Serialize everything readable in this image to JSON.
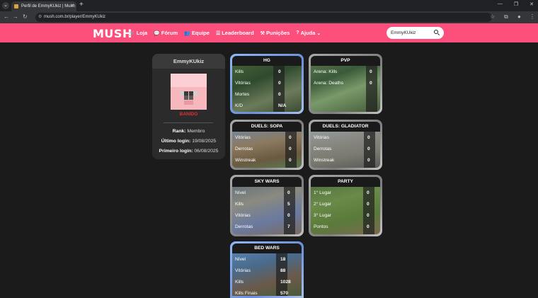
{
  "browser": {
    "tab_title": "Perfil de EmmyKUkiz | Mush",
    "url": "mush.com.br/player/EmmyKUkiz"
  },
  "site": {
    "logo": "MUSH",
    "menu": [
      {
        "label": "Loja",
        "icon": "cart-icon"
      },
      {
        "label": "Fórum",
        "icon": "chat-icon"
      },
      {
        "label": "Equipe",
        "icon": "users-icon"
      },
      {
        "label": "Leaderboard",
        "icon": "list-icon"
      },
      {
        "label": "Punições",
        "icon": "gavel-icon"
      },
      {
        "label": "Ajuda",
        "icon": "question-icon"
      }
    ],
    "search_value": "EmmyKUkiz"
  },
  "profile": {
    "name": "EmmyKUkiz",
    "status": "BANIDO",
    "rank_label": "Rank:",
    "rank_value": "Membro",
    "last_login_label": "Último login:",
    "last_login_value": "19/08/2025",
    "first_login_label": "Primeiro login:",
    "first_login_value": "06/08/2025"
  },
  "cards": {
    "hg": {
      "title": "HG",
      "rows": [
        {
          "label": "Kills",
          "value": "0"
        },
        {
          "label": "Vitórias",
          "value": "0"
        },
        {
          "label": "Mortes",
          "value": "0"
        },
        {
          "label": "K/D",
          "value": "N/A"
        }
      ]
    },
    "pvp": {
      "title": "PVP",
      "rows": [
        {
          "label": "Arena: Kills",
          "value": "0"
        },
        {
          "label": "Arena: Deaths",
          "value": "0"
        }
      ]
    },
    "sopa": {
      "title": "DUELS: SOPA",
      "rows": [
        {
          "label": "Vitórias",
          "value": "0"
        },
        {
          "label": "Derrotas",
          "value": "0"
        },
        {
          "label": "Winstreak",
          "value": "0"
        }
      ]
    },
    "glad": {
      "title": "DUELS: GLADIATOR",
      "rows": [
        {
          "label": "Vitórias",
          "value": "0"
        },
        {
          "label": "Derrotas",
          "value": "0"
        },
        {
          "label": "Winstreak",
          "value": "0"
        }
      ]
    },
    "sky": {
      "title": "SKY WARS",
      "rows": [
        {
          "label": "Nível",
          "value": "0"
        },
        {
          "label": "Kills",
          "value": "5"
        },
        {
          "label": "Vitórias",
          "value": "0"
        },
        {
          "label": "Derrotas",
          "value": "7"
        }
      ]
    },
    "party": {
      "title": "PARTY",
      "rows": [
        {
          "label": "1° Lugar",
          "value": "0"
        },
        {
          "label": "2° Lugar",
          "value": "0"
        },
        {
          "label": "3° Lugar",
          "value": "0"
        },
        {
          "label": "Pontos",
          "value": "0"
        }
      ]
    },
    "bed": {
      "title": "BED WARS",
      "rows": [
        {
          "label": "Nível",
          "value": "18"
        },
        {
          "label": "Vitórias",
          "value": "88"
        },
        {
          "label": "Kills",
          "value": "1028"
        },
        {
          "label": "Kills Finais",
          "value": "570"
        }
      ]
    }
  }
}
